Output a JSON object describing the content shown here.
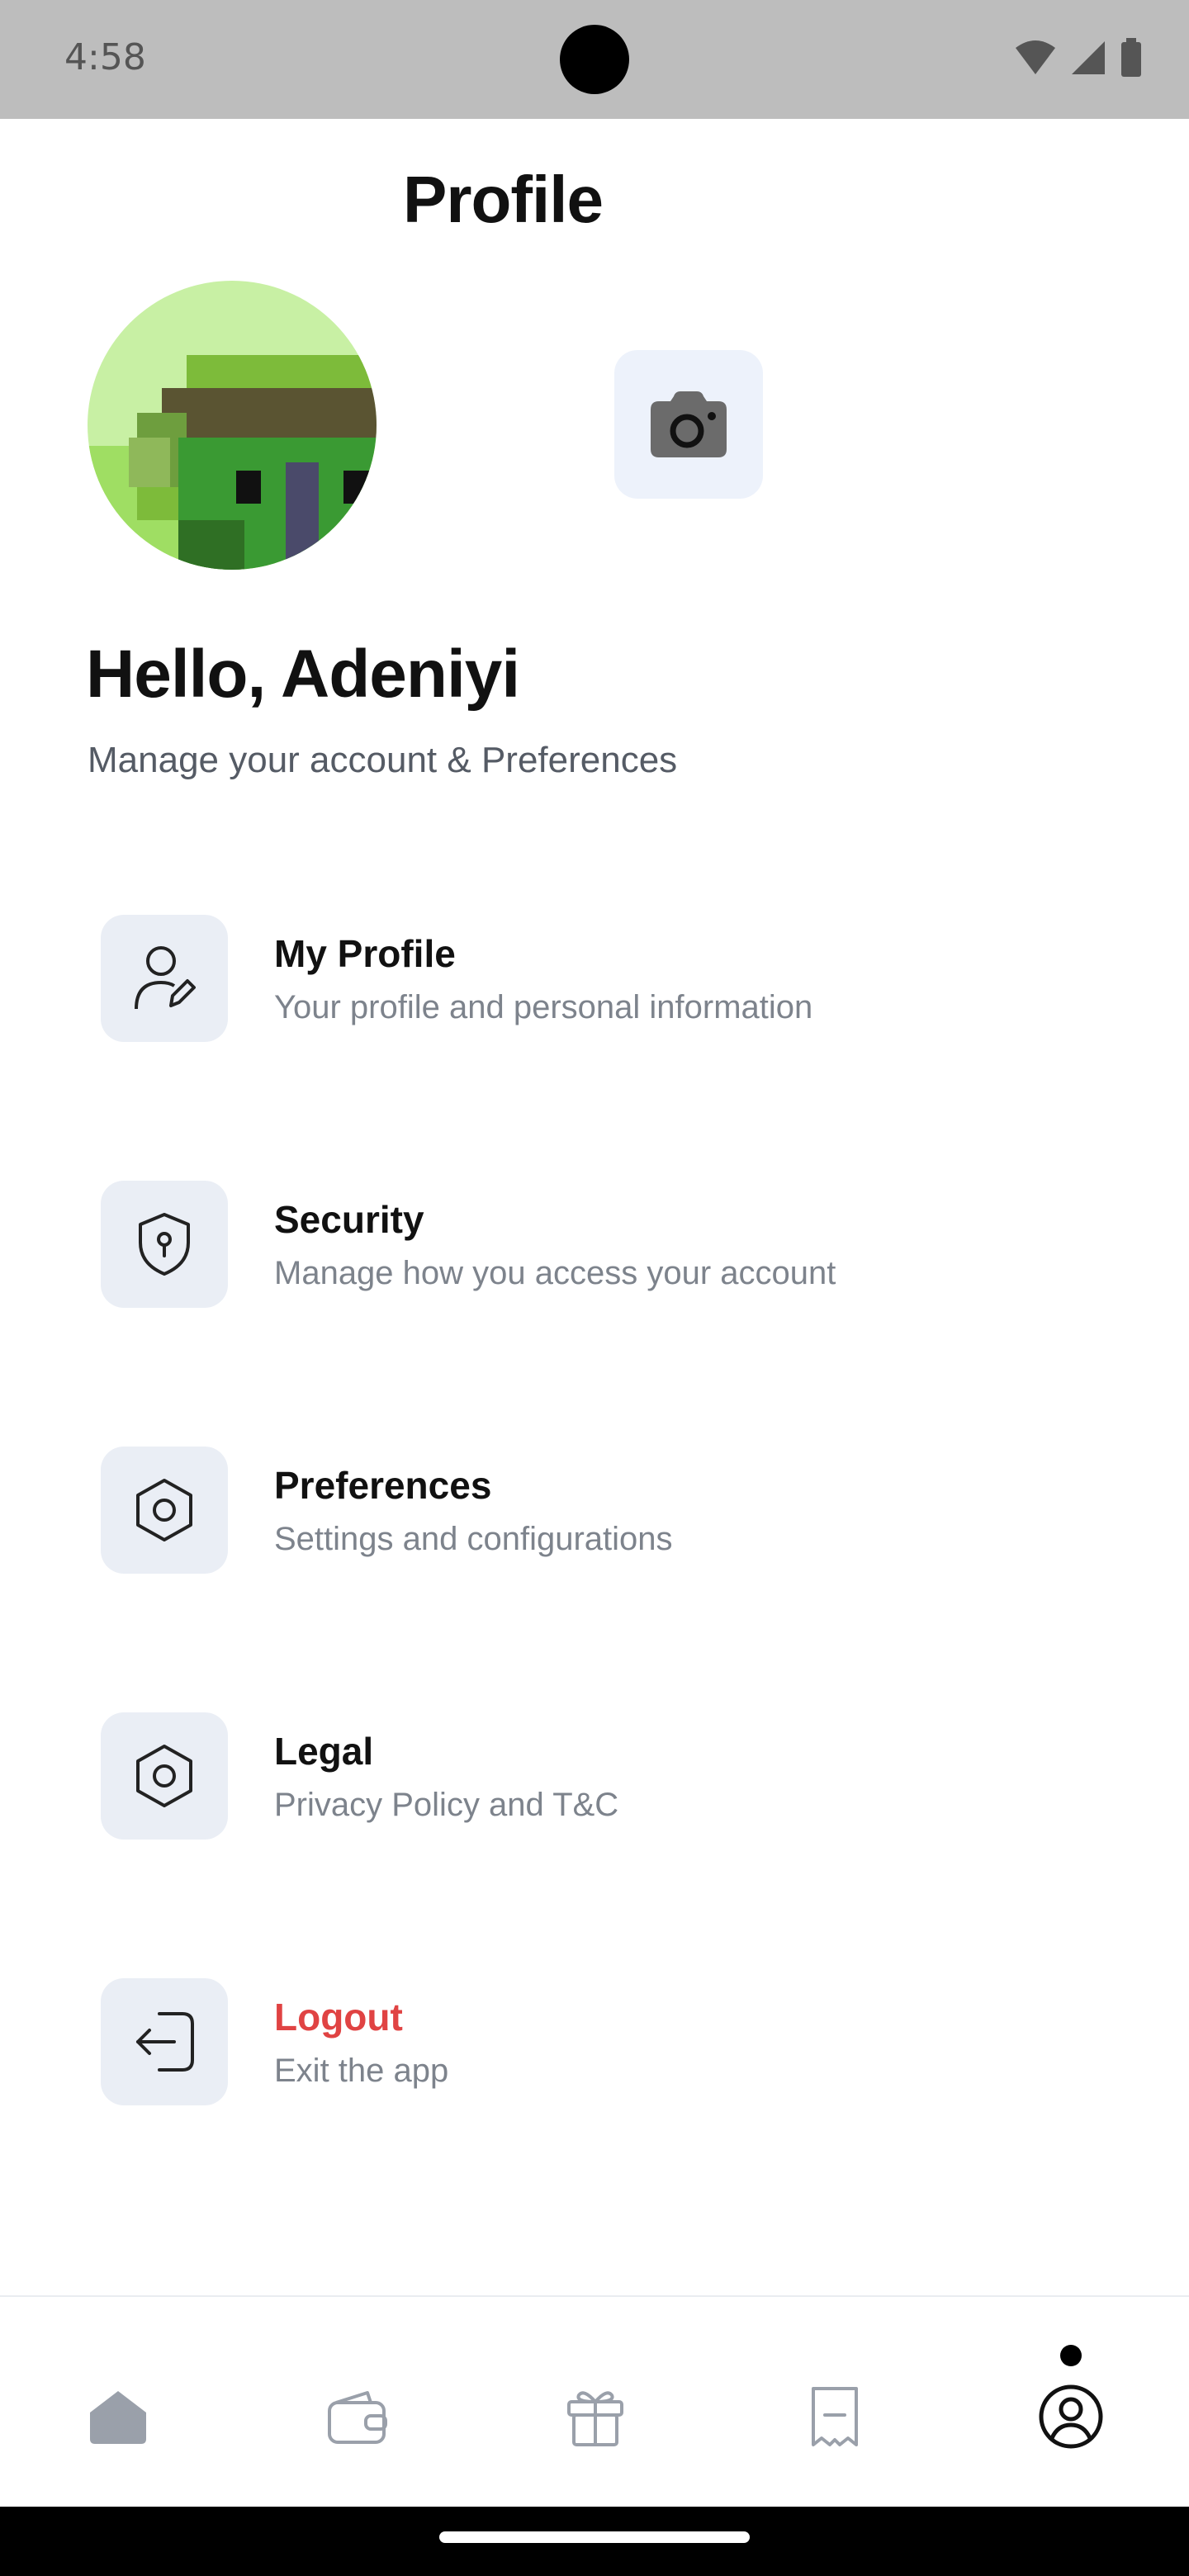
{
  "status": {
    "time": "4:58"
  },
  "header": {
    "title": "Profile"
  },
  "profile": {
    "greeting": "Hello, Adeniyi",
    "subtitle": "Manage your account & Preferences"
  },
  "menu": [
    {
      "title": "My Profile",
      "subtitle": "Your profile and personal information",
      "icon": "user-edit-icon"
    },
    {
      "title": "Security",
      "subtitle": "Manage how you access your account",
      "icon": "shield-icon"
    },
    {
      "title": "Preferences",
      "subtitle": "Settings and configurations",
      "icon": "hexagon-settings-icon"
    },
    {
      "title": "Legal",
      "subtitle": "Privacy Policy and T&C",
      "icon": "hexagon-settings-icon"
    },
    {
      "title": "Logout",
      "subtitle": "Exit the app",
      "icon": "logout-icon",
      "color": "#e04343"
    }
  ],
  "bottom_nav": [
    {
      "icon": "home-icon",
      "active": false
    },
    {
      "icon": "wallet-icon",
      "active": false
    },
    {
      "icon": "gift-icon",
      "active": false
    },
    {
      "icon": "receipt-icon",
      "active": false
    },
    {
      "icon": "profile-icon",
      "active": true
    }
  ],
  "colors": {
    "accent_bg": "#eaeef5",
    "danger": "#e04343",
    "muted_text": "#7d838c"
  }
}
